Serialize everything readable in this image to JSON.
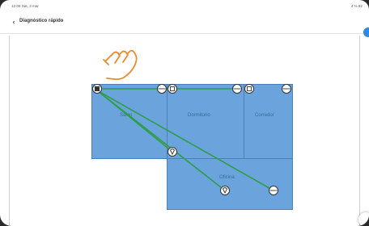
{
  "status_bar": {
    "time": "12:06 Sat, 2 mar",
    "system": "4 % 82"
  },
  "app_bar": {
    "title": "Diagnóstico rápido",
    "back_icon": "chevron-left-icon"
  },
  "rooms": [
    {
      "name": "Salon"
    },
    {
      "name": "Dormitorio"
    },
    {
      "name": "Corredor"
    },
    {
      "name": "Oficina"
    }
  ],
  "devices": [
    {
      "type": "router",
      "icon": "router-icon"
    },
    {
      "type": "wifi-extender",
      "icon": "plug-icon"
    },
    {
      "type": "wifi-extender",
      "icon": "plug-icon"
    },
    {
      "type": "speed-test-point",
      "icon": "signal-point-icon"
    },
    {
      "type": "speed-test-point",
      "icon": "signal-point-icon"
    },
    {
      "type": "speed-test-point",
      "icon": "signal-point-icon"
    },
    {
      "type": "speed-test-point",
      "icon": "signal-point-icon"
    },
    {
      "type": "speed-test-point",
      "icon": "signal-point-icon"
    }
  ],
  "colors": {
    "room_fill": "#6ba3dd",
    "room_border": "#4c7fb3",
    "connection_line": "#2e9e48",
    "tap_hint": "#e88a2c",
    "accent": "#2d8be0"
  },
  "hint_icon": "tap-hand-icon"
}
